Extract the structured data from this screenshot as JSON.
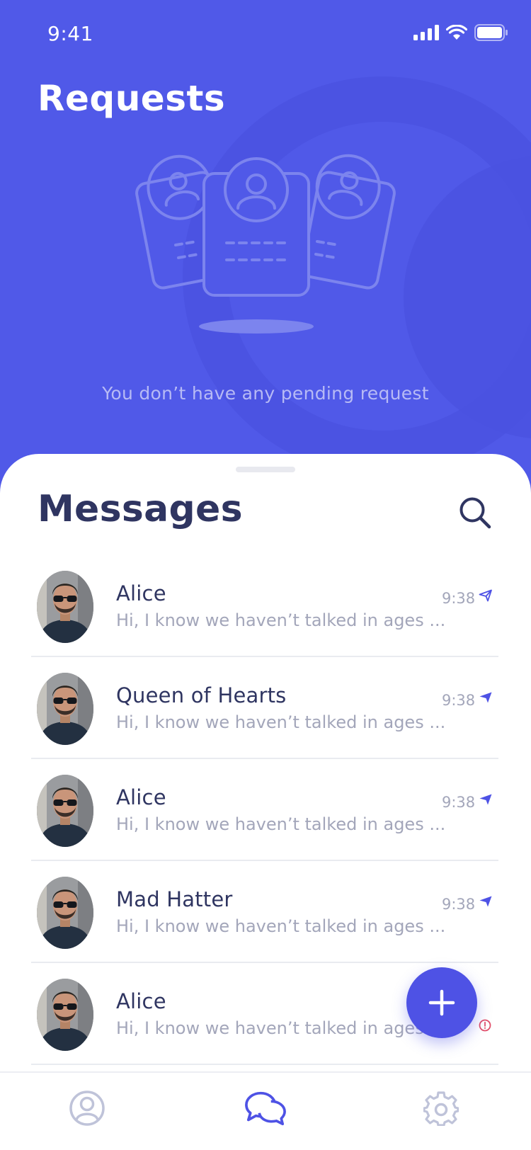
{
  "status_bar": {
    "time": "9:41"
  },
  "header": {
    "title": "Requests"
  },
  "requests": {
    "empty_message": "You don’t have any pending request"
  },
  "messages": {
    "title": "Messages",
    "items": [
      {
        "name": "Alice",
        "preview": "Hi, I know we haven’t talked in ages ...",
        "time": "9:38",
        "status_icon": "sent-outline-icon"
      },
      {
        "name": "Queen of Hearts",
        "preview": "Hi, I know we haven’t talked in ages ...",
        "time": "9:38",
        "status_icon": "sent-filled-icon"
      },
      {
        "name": "Alice",
        "preview": "Hi, I know we haven’t talked in ages ...",
        "time": "9:38",
        "status_icon": "sent-filled-icon"
      },
      {
        "name": "Mad Hatter",
        "preview": "Hi, I know we haven’t talked in ages ...",
        "time": "9:38",
        "status_icon": "sent-filled-icon"
      },
      {
        "name": "Alice",
        "preview": "Hi, I know we haven’t talked in ages ...",
        "time": "",
        "status_icon": "error-icon"
      }
    ]
  },
  "tabbar": {
    "items": [
      "profile-icon",
      "chat-icon",
      "settings-icon"
    ],
    "active": "chat-icon"
  },
  "colors": {
    "accent": "#5059e8",
    "title_text": "#2f3561",
    "muted_text": "#a3a6ba",
    "error": "#e2506b"
  }
}
